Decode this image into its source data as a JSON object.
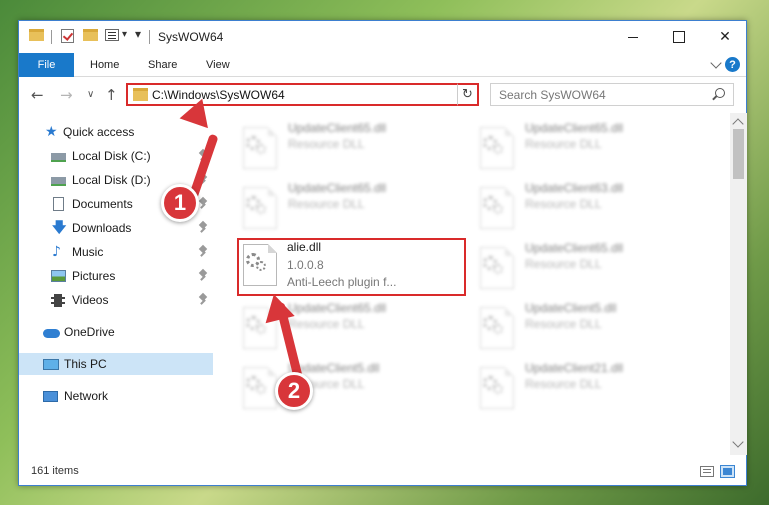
{
  "window": {
    "title": "SysWOW64",
    "controls": {
      "minimize": "minimize",
      "maximize": "maximize",
      "close": "close"
    }
  },
  "ribbon": {
    "tabs": [
      "File",
      "Home",
      "Share",
      "View"
    ],
    "help": "?"
  },
  "navbar": {
    "back": "←",
    "forward": "→",
    "recent": "∨",
    "up": "↑",
    "address": "C:\\Windows\\SysWOW64",
    "refresh": "↻",
    "search_placeholder": "Search SysWOW64"
  },
  "sidebar": {
    "items": [
      {
        "label": "Quick access",
        "icon": "star-icon",
        "pinned": false
      },
      {
        "label": "Local Disk (C:)",
        "icon": "disk-icon",
        "pinned": true
      },
      {
        "label": "Local Disk (D:)",
        "icon": "disk-icon",
        "pinned": true
      },
      {
        "label": "Documents",
        "icon": "document-icon",
        "pinned": true
      },
      {
        "label": "Downloads",
        "icon": "download-icon",
        "pinned": true
      },
      {
        "label": "Music",
        "icon": "music-icon",
        "pinned": true
      },
      {
        "label": "Pictures",
        "icon": "picture-icon",
        "pinned": true
      },
      {
        "label": "Videos",
        "icon": "video-icon",
        "pinned": true
      },
      {
        "label": "OneDrive",
        "icon": "cloud-icon",
        "pinned": false
      },
      {
        "label": "This PC",
        "icon": "pc-icon",
        "pinned": false,
        "selected": true
      },
      {
        "label": "Network",
        "icon": "network-icon",
        "pinned": false
      }
    ]
  },
  "files": [
    {
      "name": "UpdateClient65.dll",
      "line2": "Resource DLL",
      "line3": "",
      "blurred": true
    },
    {
      "name": "UpdateClient65.dll",
      "line2": "Resource DLL",
      "line3": "",
      "blurred": true
    },
    {
      "name": "UpdateClient65.dll",
      "line2": "Resource DLL",
      "line3": "",
      "blurred": true
    },
    {
      "name": "UpdateClient63.dll",
      "line2": "Resource DLL",
      "line3": "",
      "blurred": true
    },
    {
      "name": "alie.dll",
      "line2": "1.0.0.8",
      "line3": "Anti-Leech plugin f...",
      "blurred": false,
      "highlighted": true
    },
    {
      "name": "UpdateClient65.dll",
      "line2": "Resource DLL",
      "line3": "",
      "blurred": true
    },
    {
      "name": "UpdateClient65.dll",
      "line2": "Resource DLL",
      "line3": "",
      "blurred": true
    },
    {
      "name": "UpdateClient5.dll",
      "line2": "Resource DLL",
      "line3": "",
      "blurred": true
    },
    {
      "name": "UpdateClient5.dll",
      "line2": "Resource DLL",
      "line3": "",
      "blurred": true
    },
    {
      "name": "UpdateClient21.dll",
      "line2": "Resource DLL",
      "line3": "",
      "blurred": true
    }
  ],
  "statusbar": {
    "count": "161 items"
  },
  "annotations": {
    "step1": "1",
    "step2": "2"
  },
  "colors": {
    "accent": "#1979ca",
    "highlight": "#d92a2a",
    "selected_nav": "#cce4f7"
  }
}
